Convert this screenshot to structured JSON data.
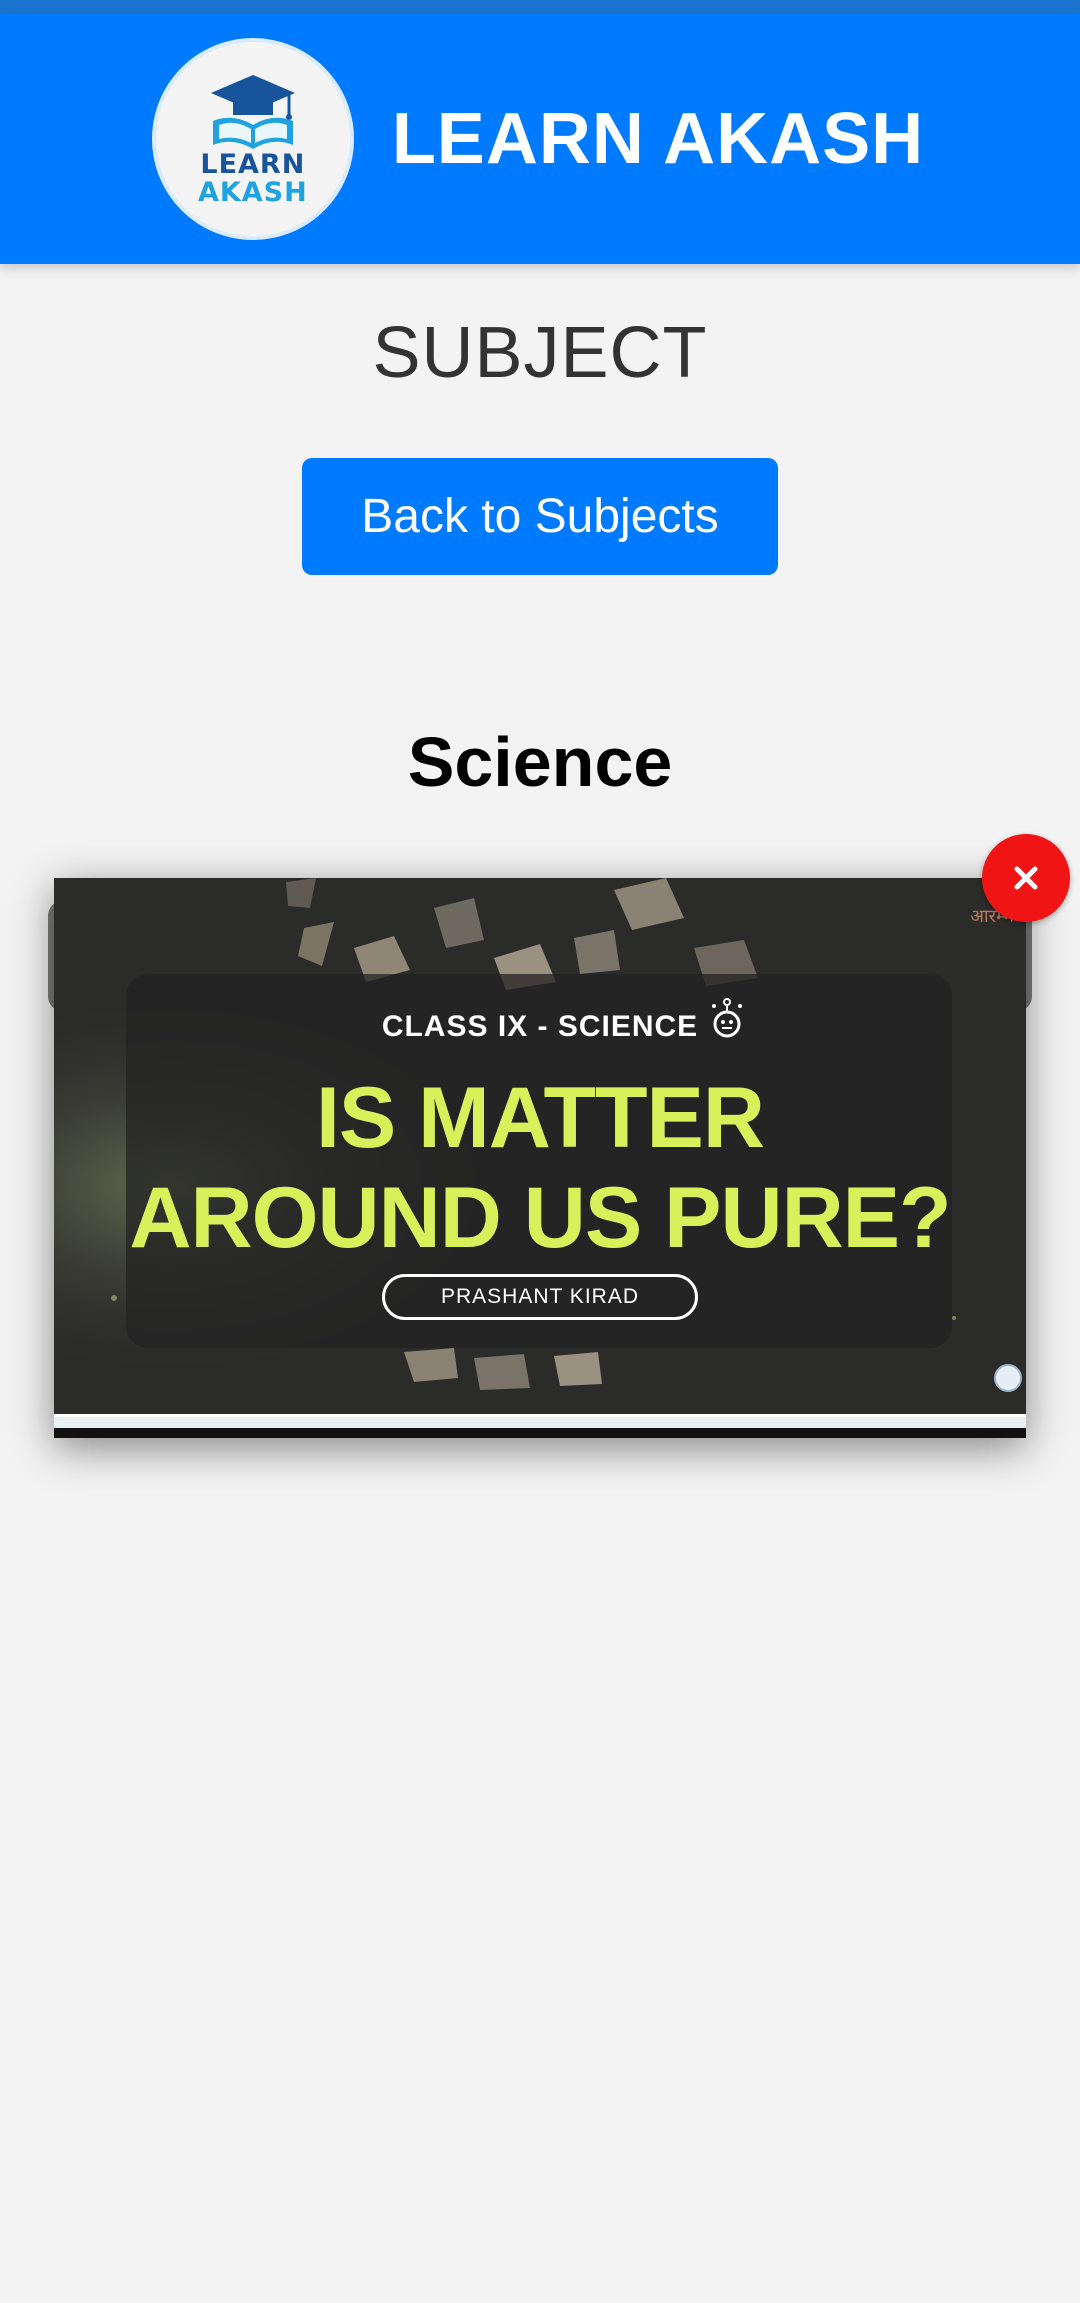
{
  "header": {
    "logo_line1": "LEARN",
    "logo_line2": "AKASH",
    "title": "LEARN AKASH",
    "background_color": "#007bff"
  },
  "page": {
    "heading": "SUBJECT",
    "back_button_label": "Back to Subjects",
    "section_title": "Science"
  },
  "video": {
    "kicker": "CLASS IX - SCIENCE",
    "headline_line1": "IS MATTER",
    "headline_line2": "AROUND US PURE?",
    "author": "PRASHANT KIRAD",
    "corner_text": "आरम्भ",
    "headline_color": "#d8f15a"
  },
  "close_button": {
    "icon": "close-icon",
    "symbol": "✕",
    "color": "#f01414"
  }
}
